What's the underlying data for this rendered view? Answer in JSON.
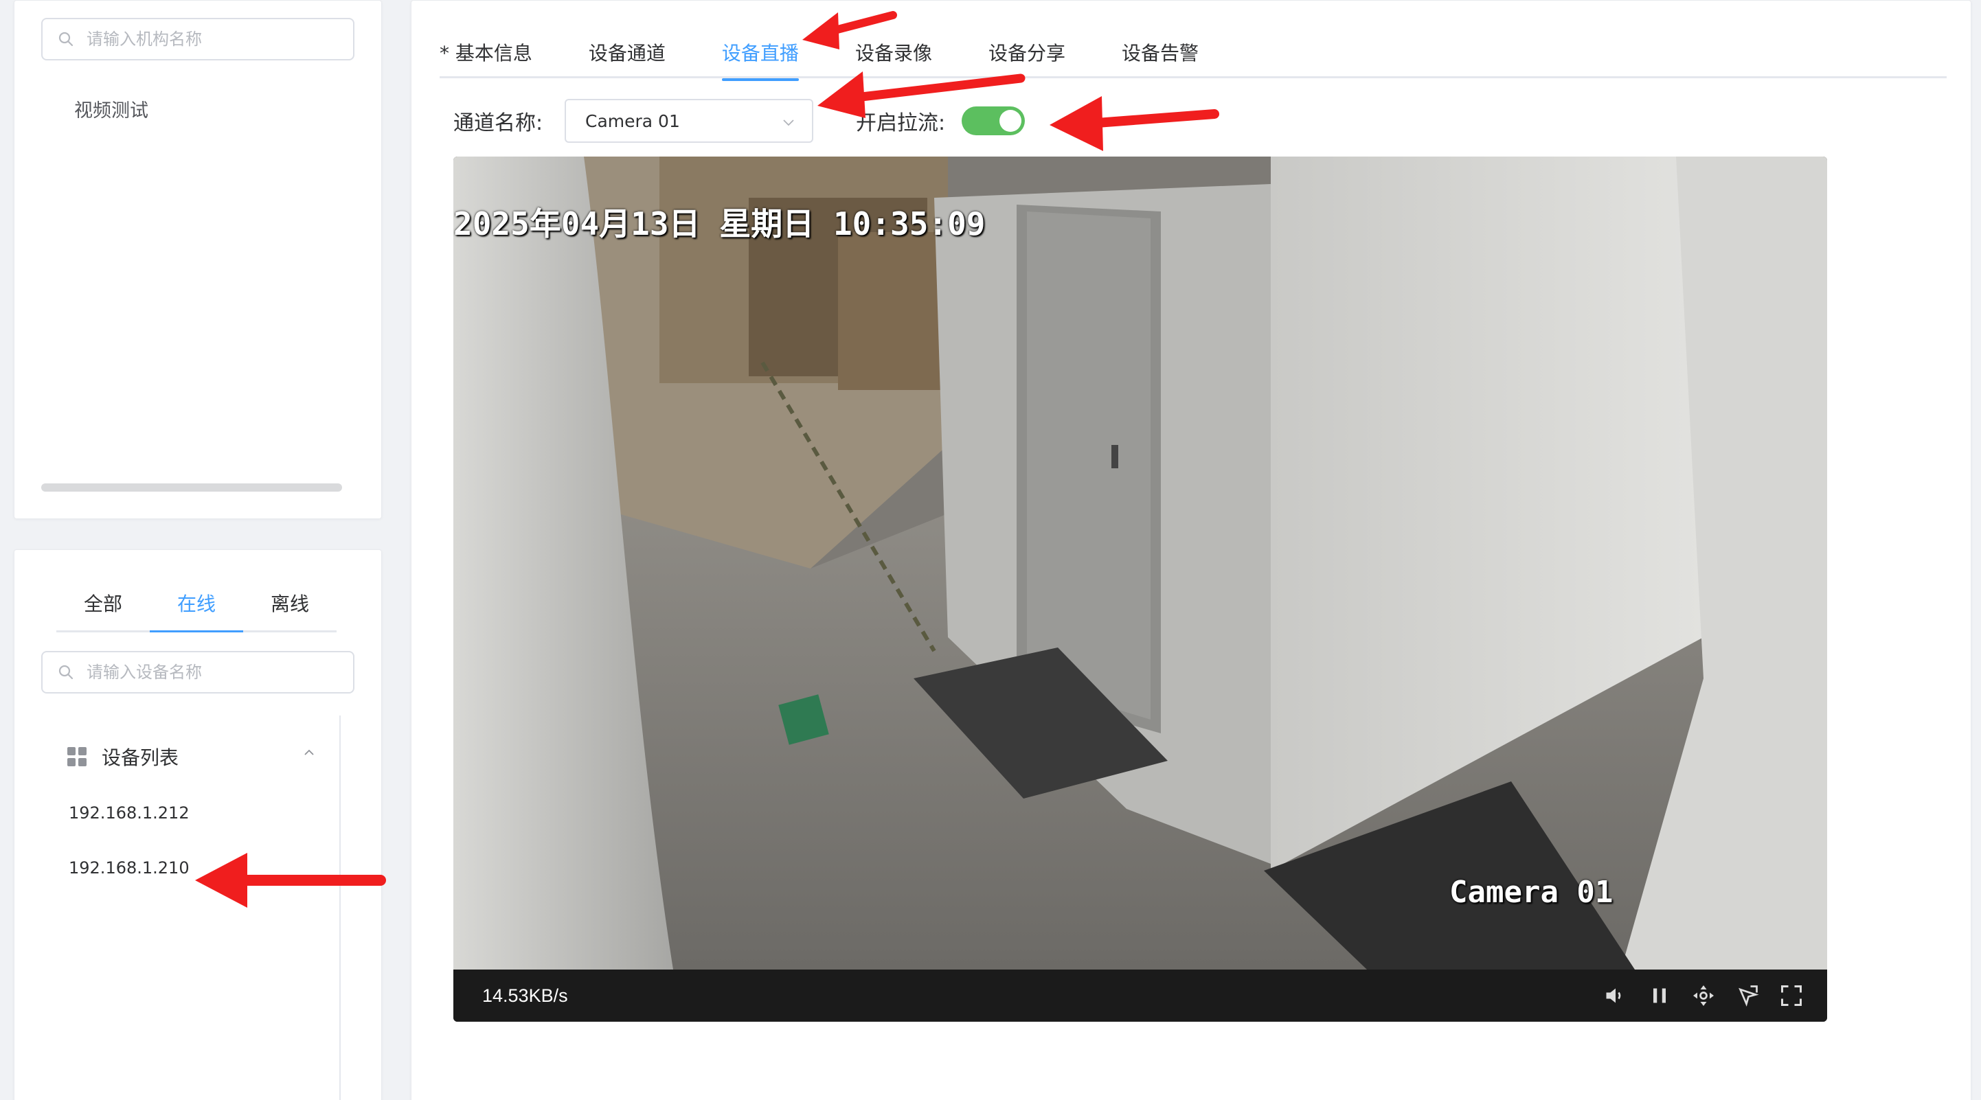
{
  "sidebar": {
    "org_search_placeholder": "请输入机构名称",
    "org_items": [
      "视频测试"
    ],
    "status_tabs": [
      "全部",
      "在线",
      "离线"
    ],
    "status_active": "在线",
    "device_search_placeholder": "请输入设备名称",
    "tree_title": "设备列表",
    "devices": [
      "192.168.1.212",
      "192.168.1.210"
    ]
  },
  "main": {
    "tabs": [
      "* 基本信息",
      "设备通道",
      "设备直播",
      "设备录像",
      "设备分享",
      "设备告警"
    ],
    "active_tab": "设备直播",
    "channel_label": "通道名称:",
    "channel_value": "Camera 01",
    "stream_label": "开启拉流:",
    "stream_enabled": true
  },
  "player": {
    "osd_timestamp": "2025年04月13日  星期日  10:35:09",
    "osd_camera": "Camera 01",
    "bitrate": "14.53KB/s",
    "controls": [
      "volume-icon",
      "pause-icon",
      "ptz-icon",
      "screenshot-icon",
      "fullscreen-icon"
    ]
  },
  "colors": {
    "accent": "#409eff",
    "switch_on": "#5cbf5f",
    "annotation_arrow": "#f01e1e"
  }
}
